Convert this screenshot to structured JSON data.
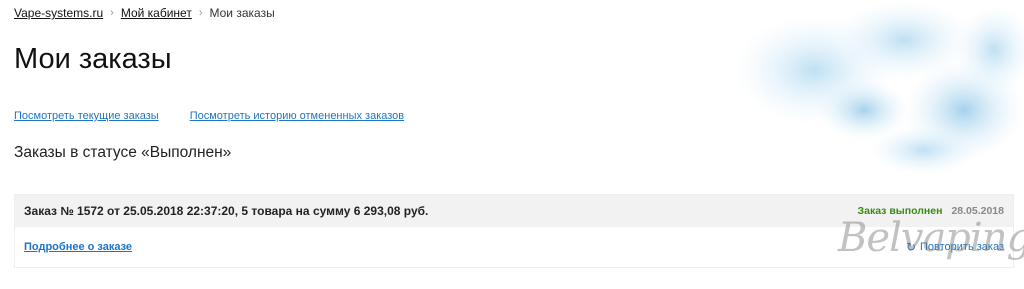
{
  "breadcrumb": {
    "home": "Vape-systems.ru",
    "cabinet": "Мой кабинет",
    "current": "Мои заказы"
  },
  "page_title": "Мои заказы",
  "links": {
    "current_orders": "Посмотреть текущие заказы",
    "cancelled_history": "Посмотреть историю отмененных заказов"
  },
  "status_heading": "Заказы в статусе «Выполнен»",
  "order": {
    "title": "Заказ № 1572 от 25.05.2018 22:37:20, 5 товара на сумму 6 293,08 руб.",
    "status": "Заказ выполнен",
    "date": "28.05.2018",
    "details_link": "Подробнее о заказе",
    "repeat_label": "Повторить заказ",
    "repeat_icon": "refresh-icon"
  },
  "watermark": "Belvaping.com",
  "colors": {
    "link": "#1e74c6",
    "status_done": "#3a8a12",
    "row_bg": "#f2f2f2"
  }
}
